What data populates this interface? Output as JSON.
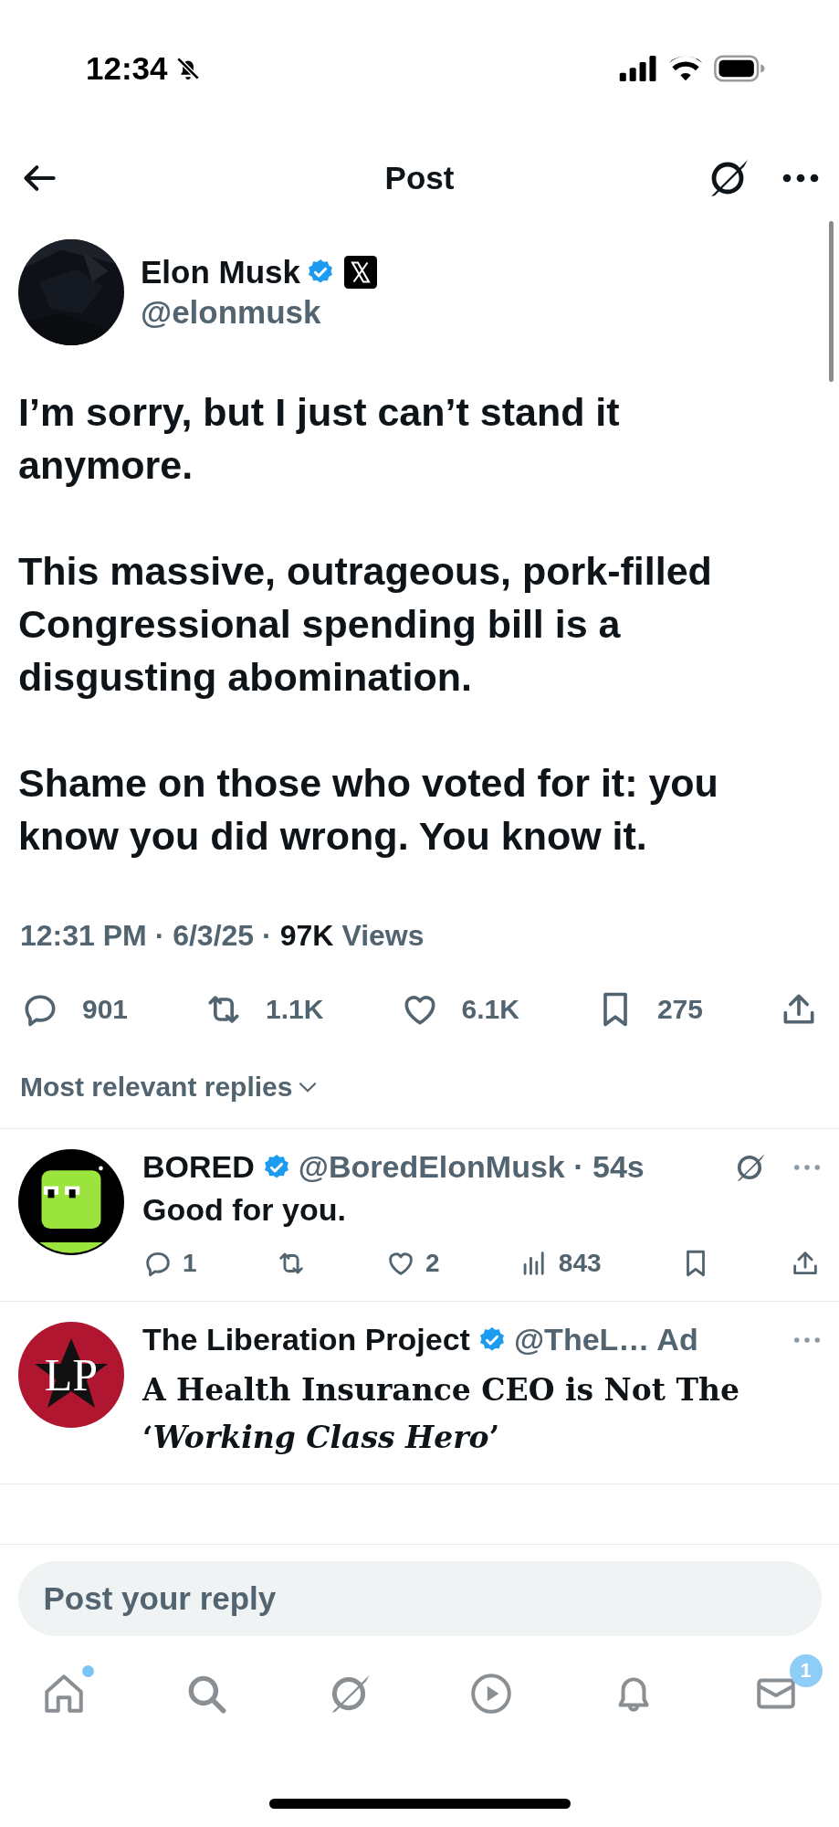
{
  "status_bar": {
    "time": "12:34",
    "silent": true
  },
  "header": {
    "title": "Post"
  },
  "post": {
    "author": {
      "name": "Elon Musk",
      "verified": true,
      "handle": "@elonmusk"
    },
    "paragraphs": [
      "I’m sorry, but I just can’t stand it anymore.",
      "This massive, outrageous, pork-filled Congressional spending bill is a disgusting abomination.",
      "Shame on those who voted for it: you know you did wrong. You know it."
    ],
    "meta": "12:31 PM · 6/3/25 ·",
    "views_count": "97K",
    "views_label": "Views",
    "actions": [
      {
        "kind": "reply",
        "count": "901"
      },
      {
        "kind": "repost",
        "count": "1.1K"
      },
      {
        "kind": "like",
        "count": "6.1K"
      },
      {
        "kind": "bookmark",
        "count": "275"
      },
      {
        "kind": "share"
      }
    ]
  },
  "sort": {
    "label": "Most relevant replies"
  },
  "replies": [
    {
      "kind": "reply",
      "name": "BORED",
      "verified": true,
      "handle": "@BoredElonMusk · 54s",
      "text": "Good for you.",
      "actions": [
        {
          "kind": "reply",
          "count": "1"
        },
        {
          "kind": "repost"
        },
        {
          "kind": "like",
          "count": "2"
        },
        {
          "kind": "views",
          "count": "843"
        },
        {
          "kind": "bookmark"
        },
        {
          "kind": "share"
        }
      ]
    },
    {
      "kind": "ad",
      "name": "The Liberation Project",
      "verified": true,
      "handle": "@TheL…",
      "ad_label": "Ad",
      "logo_letters": "LP",
      "headline": "A Health Insurance CEO is Not The ‘*Working Class Hero*’"
    }
  ],
  "reply_field": {
    "placeholder": "Post your reply"
  },
  "tab_bar": [
    {
      "kind": "home",
      "dot": true
    },
    {
      "kind": "search",
      "dot": false
    },
    {
      "kind": "grok",
      "dot": false
    },
    {
      "kind": "video",
      "dot": false
    },
    {
      "kind": "notifications",
      "dot": false
    },
    {
      "kind": "messages",
      "dot": false,
      "badge": "1"
    }
  ]
}
